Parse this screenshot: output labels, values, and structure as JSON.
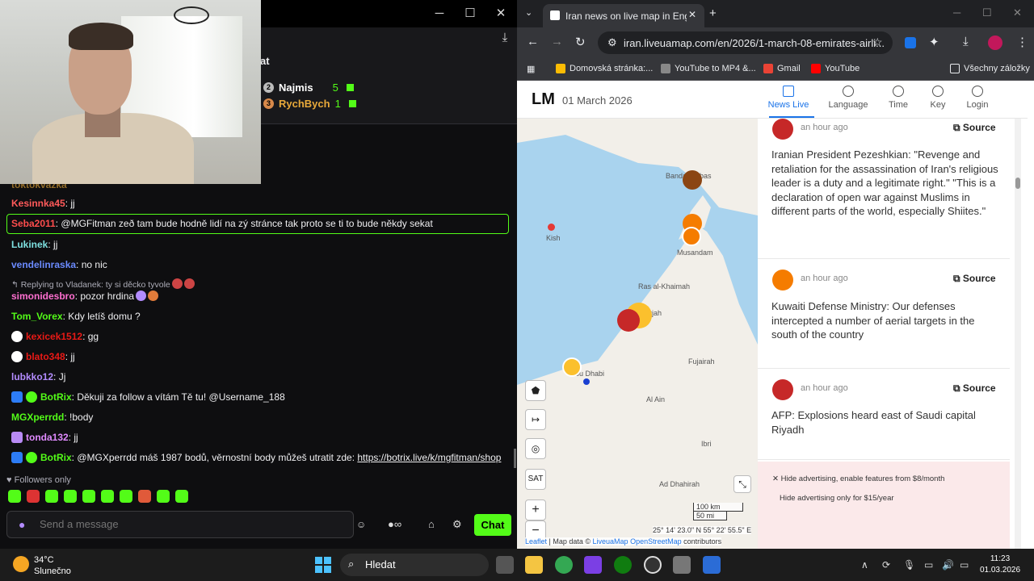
{
  "chat": {
    "leaderboard": [
      {
        "rank": "2",
        "name": "Najmis",
        "count": "5"
      },
      {
        "rank": "3",
        "name": "RychBych",
        "count": "1"
      }
    ],
    "header_title_fragment": "at",
    "top_partial_user": "toktokvazka",
    "messages": [
      {
        "user": "Kesinnka45",
        "text": ": jj",
        "color": "#ff5a5a"
      },
      {
        "user": "Seba2011",
        "text": ": @MGFitman zeð tam bude hodně lidí na zý stránce tak proto se ti to bude někdy sekat",
        "color": "#ff4d4d"
      },
      {
        "user": "Lukinek",
        "text": ": jj",
        "color": "#7ee0e0"
      },
      {
        "user": "vendelinraska",
        "text": ": no nic",
        "color": "#6b8bff"
      },
      {
        "reply": "Replying to Vladanek: ty si děcko tyvole"
      },
      {
        "user": "simonidesbro",
        "text": ": pozor hrdina",
        "color": "#ff6fd0"
      },
      {
        "user": "Tom_Vorex",
        "text": ": Kdy letíš domu ?",
        "color": "#53fc18"
      },
      {
        "user": "kexicek1512",
        "text": ": gg",
        "color": "#e91916"
      },
      {
        "user": "blato348",
        "text": ": jj",
        "color": "#e91916"
      },
      {
        "user": "lubkko12",
        "text": ": Jj",
        "color": "#b38cff"
      },
      {
        "user": "BotRix",
        "text": ": Děkuji za follow a vítám Tě tu! @Username_188",
        "color": "#53fc18"
      },
      {
        "user": "MGXperrdd",
        "text": ": !body",
        "color": "#53fc18"
      },
      {
        "user": "tonda132",
        "text": ": jj",
        "color": "#e08bff"
      },
      {
        "user": "BotRix",
        "text": ": @MGXperrdd máš 1987 bodů, věrnostní body můžeš utratit zde: ",
        "link": "https://botrix.live/k/mgfitman/shop",
        "color": "#53fc18"
      }
    ],
    "followers_only": "Followers only",
    "input_placeholder": "Send a message",
    "send_label": "Chat"
  },
  "browser": {
    "tab_title": "Iran news on live map in English",
    "url": "iran.liveuamap.com/en/2026/1-march-08-emirates-airli...",
    "bookmarks": [
      "Domovská stránka:...",
      "YouTube to MP4 &...",
      "Gmail",
      "YouTube"
    ],
    "all_bookmarks": "Všechny záložky"
  },
  "site": {
    "logo": "LM",
    "date": "01 March 2026",
    "tabs": [
      "News Live",
      "Language",
      "Time",
      "Key",
      "Login"
    ],
    "map_labels": [
      "Bandar Abbas",
      "Kish",
      "Musandam",
      "Ras al-Khaimah",
      "Sharjah",
      "Abu Dhabi",
      "Al Ain",
      "Fujairah",
      "Ad Dhahirah",
      "Ibri"
    ],
    "map_controls": {
      "sat": "SAT",
      "zoom_in": "+",
      "zoom_out": "−"
    },
    "scale_km": "100 km",
    "scale_mi": "50 mi",
    "coords": "25° 14' 23.0\" N 55° 22' 55.5\" E",
    "attribution_leaflet": "Leaflet",
    "attribution_map_data": " | Map data © ",
    "attribution_liveuamap": "LiveuaMap",
    "attribution_osm": " OpenStreetMap",
    "attribution_contributors": " contributors",
    "news": [
      {
        "time": "an hour ago",
        "source": "Source",
        "text": "Iranian President Pezeshkian: \"Revenge and retaliation for the assassination of Iran's religious leader is a duty and a legitimate right.\" \"This is a declaration of open war against Muslims in different parts of the world, especially Shiites.\""
      },
      {
        "time": "an hour ago",
        "source": "Source",
        "text": "Kuwaiti Defense Ministry: Our defenses intercepted a number of aerial targets in the south of the country"
      },
      {
        "time": "an hour ago",
        "source": "Source",
        "text": "AFP: Explosions heard east of Saudi capital Riyadh"
      }
    ],
    "ad_line1": "Hide advertising, enable features from $8/month",
    "ad_line2": "Hide advertising only for $15/year"
  },
  "taskbar": {
    "temp": "34°C",
    "weather": "Slunečno",
    "search": "Hledat",
    "time": "11:23",
    "date": "01.03.2026"
  }
}
